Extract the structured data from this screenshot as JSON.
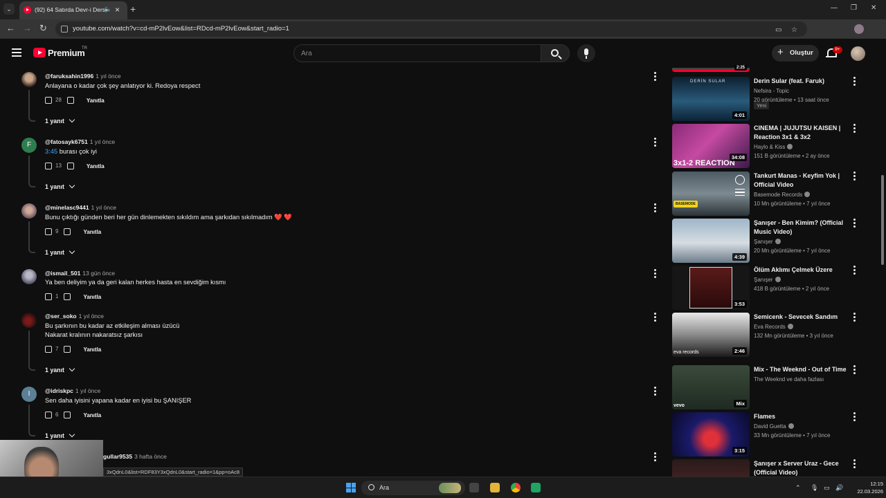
{
  "browser": {
    "tab_title": "(92) 64 Satırda Devr-i Dersi",
    "url": "youtube.com/watch?v=cd-mP2lvEow&list=RDcd-mP2lvEow&start_radio=1"
  },
  "masthead": {
    "logo_text": "Premium",
    "country_code": "TR",
    "search_placeholder": "Ara",
    "create_label": "Oluştur",
    "notif_count": "9+"
  },
  "comments": [
    {
      "user": "@faruksahin1996",
      "time": "1 yıl önce",
      "lines": [
        "Anlayana o kadar çok şey anlatıyor ki. Redoya respect"
      ],
      "likes": "28",
      "reply_label": "Yanıtla",
      "replies": "1 yanıt",
      "avatar": "photo"
    },
    {
      "user": "@fatosayk6751",
      "time": "1 yıl önce",
      "timestamp": "3:45",
      "lines": [
        " burası çok iyi"
      ],
      "likes": "13",
      "reply_label": "Yanıtla",
      "replies": "1 yanıt",
      "avatar": "F"
    },
    {
      "user": "@minelasc9441",
      "time": "1 yıl önce",
      "lines": [
        "Bunu çıktığı günden beri her gün dinlemekten sıkıldım ama şarkıdan sıkılmadım"
      ],
      "hearts": "❤️ ❤️",
      "likes": "9",
      "reply_label": "Yanıtla",
      "replies": "1 yanıt",
      "avatar": "photo"
    },
    {
      "user": "@ismail_501",
      "time": "13 gün önce",
      "lines": [
        "Ya ben deliyim ya da geri kalan herkes hasta en sevdiğim kısmı"
      ],
      "likes": "1",
      "reply_label": "Yanıtla",
      "avatar": "photo"
    },
    {
      "user": "@ser_soko",
      "time": "1 yıl önce",
      "lines": [
        "Bu şarkının bu kadar az etkileşim alması üzücü",
        "Nakarat kralının nakaratsız şarkısı"
      ],
      "likes": "7",
      "reply_label": "Yanıtla",
      "replies": "1 yanıt",
      "avatar": "photo"
    },
    {
      "user": "@idriskpc",
      "time": "1 yıl önce",
      "lines": [
        "Sen daha iyisini yapana kadar en iyisi bu ŞANIŞER"
      ],
      "likes": "6",
      "reply_label": "Yanıtla",
      "replies": "1 yanıt",
      "avatar": "I"
    },
    {
      "user": "gullar9535",
      "time": "3 hafta önce"
    }
  ],
  "status_url": "3xQdnL0&list=RDF83Y3xQdnL0&start_radio=1&pp=oAc8",
  "recommendations": [
    {
      "title": "Derin Sular (feat. Faruk)",
      "channel": "Nefsira - Topic",
      "meta": "20 görüntüleme • 13 saat önce",
      "badge": "Yeni",
      "duration": "4:01",
      "thumb_text": "DERİN SULAR"
    },
    {
      "title": "CINEMA | JUJUTSU KAISEN | Reaction 3x1 & 3x2",
      "channel": "Haylo & Kiss",
      "verified": true,
      "meta": "151 B görüntüleme • 2 ay önce",
      "duration": "34:08",
      "thumb_text": "3x1-2 REACTION"
    },
    {
      "title": "Tankurt Manas - Keyfim Yok | Official Video",
      "channel": "Basemode Records",
      "verified": true,
      "meta": "10 Mn görüntüleme • 7 yıl önce",
      "thumb_text": "BASEMODE"
    },
    {
      "title": "Şanışer - Ben Kimim? (Official Music Video)",
      "channel": "Şanışer",
      "verified": true,
      "meta": "20 Mn görüntüleme • 7 yıl önce",
      "duration": "4:39"
    },
    {
      "title": "Ölüm Aklımı Çelmek Üzere",
      "channel": "Şanışer",
      "verified": true,
      "meta": "418 B görüntüleme • 2 yıl önce",
      "duration": "3:53"
    },
    {
      "title": "Semicenk - Sevecek Sandım",
      "channel": "Eva Records",
      "verified": true,
      "meta": "132 Mn görüntüleme • 3 yıl önce",
      "duration": "2:46",
      "thumb_text": "eva records"
    },
    {
      "title": "Mix - The Weeknd - Out of Time",
      "channel": "The Weeknd ve daha fazlası",
      "duration": "Mix",
      "thumb_text": "vevo"
    },
    {
      "title": "Flames",
      "channel": "David Guetta",
      "verified": true,
      "meta": "33 Mn görüntüleme • 7 yıl önce",
      "duration": "3:15"
    },
    {
      "title": "Şanışer x Server Uraz - Gece (Official Video)",
      "channel": ""
    }
  ],
  "top_partial_duration": "2:25",
  "taskbar": {
    "search_label": "Ara",
    "time": "12:15",
    "date": "22.03.2026"
  }
}
